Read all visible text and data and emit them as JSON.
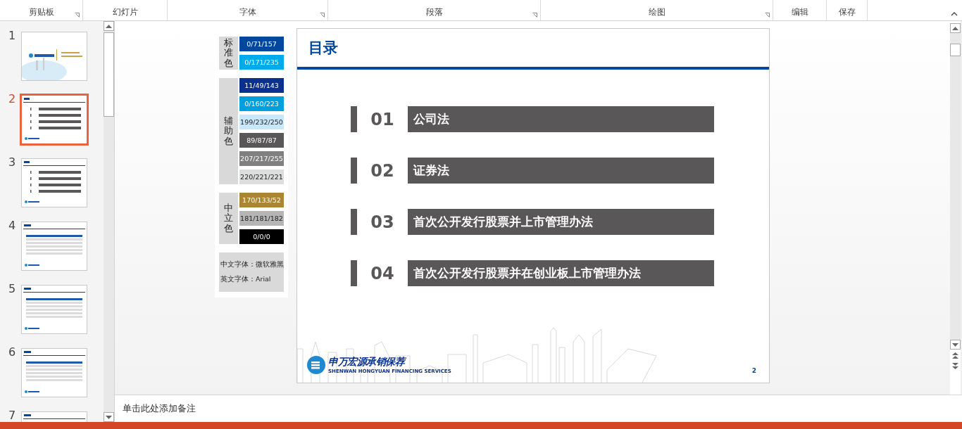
{
  "ribbon": {
    "groups": [
      {
        "label": "剪贴板",
        "launcher": true
      },
      {
        "label": "幻灯片",
        "launcher": false
      },
      {
        "label": "字体",
        "launcher": true
      },
      {
        "label": "段落",
        "launcher": true
      },
      {
        "label": "绘图",
        "launcher": true
      },
      {
        "label": "编辑",
        "launcher": false
      },
      {
        "label": "保存",
        "launcher": false
      }
    ]
  },
  "thumbnails": [
    {
      "number": "1",
      "kind": "cover",
      "selected": false
    },
    {
      "number": "2",
      "kind": "toc",
      "selected": true
    },
    {
      "number": "3",
      "kind": "toc",
      "selected": false
    },
    {
      "number": "4",
      "kind": "table",
      "selected": false
    },
    {
      "number": "5",
      "kind": "table",
      "selected": false
    },
    {
      "number": "6",
      "kind": "table",
      "selected": false
    },
    {
      "number": "7",
      "kind": "table",
      "selected": false
    }
  ],
  "palette": {
    "groups": [
      {
        "label": "标准色",
        "swatches": [
          {
            "text": "0/71/157",
            "color": "#00479d"
          },
          {
            "text": "0/171/235",
            "color": "#00abeb"
          }
        ]
      },
      {
        "label": "辅助色",
        "swatches": [
          {
            "text": "11/49/143",
            "color": "#0b318f"
          },
          {
            "text": "0/160/223",
            "color": "#00a0df"
          },
          {
            "text": "199/232/250",
            "color": "#c7e8fa"
          },
          {
            "text": "89/87/87",
            "color": "#595757"
          },
          {
            "text": "207/217/255",
            "color": "#808080"
          },
          {
            "text": "220/221/221",
            "color": "#dcdddd"
          }
        ]
      },
      {
        "label": "中立色",
        "swatches": [
          {
            "text": "170/133/52",
            "color": "#aa8534"
          },
          {
            "text": "181/181/182",
            "color": "#b5b5b6"
          },
          {
            "text": "0/0/0",
            "color": "#000000"
          }
        ]
      }
    ],
    "fonts": [
      "中文字体：微软雅黑",
      "英文字体：Arial"
    ]
  },
  "slide": {
    "title": "目录",
    "items": [
      {
        "number": "01",
        "text": "公司法"
      },
      {
        "number": "02",
        "text": "证券法"
      },
      {
        "number": "03",
        "text": "首次公开发行股票并上市管理办法"
      },
      {
        "number": "04",
        "text": "首次公开发行股票并在创业板上市管理办法"
      }
    ],
    "logo_name": "申万宏源承销保荐",
    "logo_sub": "SHENWAN HONGYUAN FINANCING SERVICES",
    "page_number": "2"
  },
  "notes": {
    "placeholder": "单击此处添加备注"
  }
}
